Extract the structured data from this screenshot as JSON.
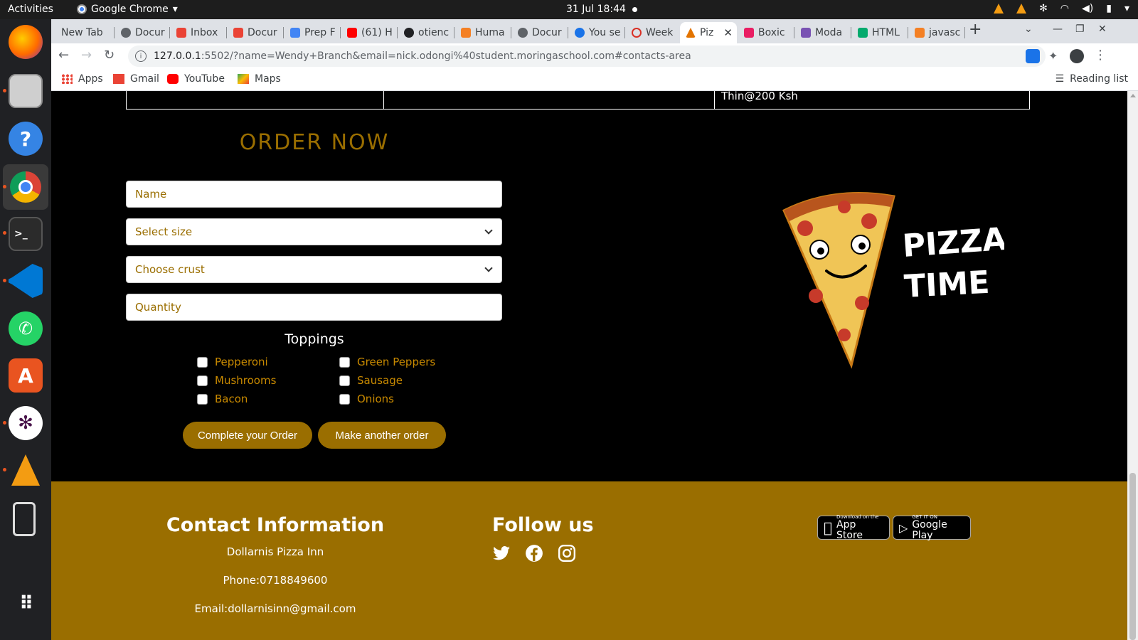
{
  "system": {
    "activities": "Activities",
    "app_name": "Google Chrome",
    "clock": "31 Jul  18:44"
  },
  "browser": {
    "tabs": [
      {
        "label": "New Tab",
        "color": "#dee1e6"
      },
      {
        "label": "Docur",
        "color": "#5f6368"
      },
      {
        "label": "Inbox",
        "color": "#ea4335"
      },
      {
        "label": "Docur",
        "color": "#ea4335"
      },
      {
        "label": "Prep F",
        "color": "#4285f4"
      },
      {
        "label": "(61) H",
        "color": "#ff0000"
      },
      {
        "label": "otienc",
        "color": "#202124"
      },
      {
        "label": "Huma",
        "color": "#f48024"
      },
      {
        "label": "Docur",
        "color": "#5f6368"
      },
      {
        "label": "You se",
        "color": "#1a73e8"
      },
      {
        "label": "Week",
        "color": "#d93025"
      },
      {
        "label": "Piz",
        "color": "#e37400"
      },
      {
        "label": "Boxic",
        "color": "#e91e63"
      },
      {
        "label": "Moda",
        "color": "#7952b3"
      },
      {
        "label": "HTML",
        "color": "#04aa6d"
      },
      {
        "label": "javasc",
        "color": "#f48024"
      }
    ],
    "url_host": "127.0.0.1",
    "url_rest": ":5502/?name=Wendy+Branch&email=nick.odongi%40student.moringaschool.com#contacts-area",
    "bookmarks": {
      "apps": "Apps",
      "gmail": "Gmail",
      "youtube": "YouTube",
      "maps": "Maps",
      "reading_list": "Reading list"
    }
  },
  "page": {
    "table_cell": "Thin@200 Ksh",
    "order_title": "ORDER NOW",
    "form": {
      "name_placeholder": "Name",
      "size_placeholder": "Select size",
      "crust_placeholder": "Choose crust",
      "quantity_placeholder": "Quantity",
      "toppings_title": "Toppings",
      "toppings": [
        "Pepperoni",
        "Green Peppers",
        "Mushrooms",
        "Sausage",
        "Bacon",
        "Onions"
      ],
      "complete_button": "Complete your Order",
      "another_button": "Make another order"
    },
    "pizza_art_text": [
      "PIZZA",
      "TIME"
    ],
    "footer": {
      "contact_title": "Contact Information",
      "business_name": "Dollarnis Pizza Inn",
      "phone": "Phone:0718849600",
      "email": "Email:dollarnisinn@gmail.com",
      "follow_title": "Follow us",
      "app_store_small": "Download on the",
      "app_store_big": "App Store",
      "google_play_small": "GET IT ON",
      "google_play_big": "Google Play"
    },
    "colors": {
      "accent": "#9a6e00",
      "background": "#000000"
    }
  }
}
